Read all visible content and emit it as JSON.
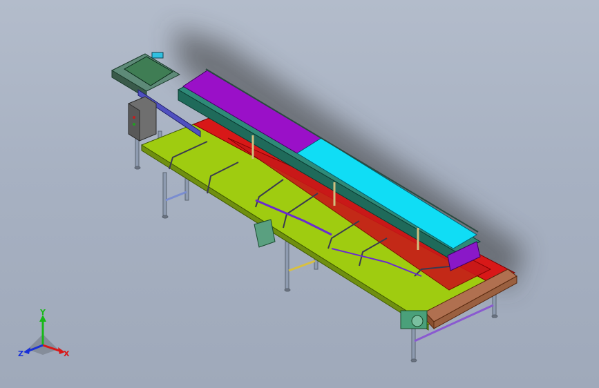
{
  "viewport": {
    "background_top": "#b3bccb",
    "background_bottom": "#9fa9ba"
  },
  "model": {
    "parts": [
      {
        "name": "feed-hopper",
        "color": "#3f7d54"
      },
      {
        "name": "control-box",
        "color": "#6f6f6f"
      },
      {
        "name": "upper-belt-purple",
        "color": "#9a10c8"
      },
      {
        "name": "upper-belt-cyan",
        "color": "#10ddf5"
      },
      {
        "name": "upper-conveyor-frame",
        "color": "#2f8a78"
      },
      {
        "name": "lower-belt-red",
        "color": "#d81818"
      },
      {
        "name": "side-table",
        "color": "#9fcc10"
      },
      {
        "name": "end-roller-housing",
        "color": "#b07050"
      },
      {
        "name": "legs",
        "color": "#8e9bb0"
      },
      {
        "name": "drive-motor",
        "color": "#4aa07a"
      }
    ]
  },
  "triad": {
    "x_label": "X",
    "y_label": "Y",
    "z_label": "Z",
    "x_color": "#d81818",
    "y_color": "#18b818",
    "z_color": "#1830d8"
  }
}
